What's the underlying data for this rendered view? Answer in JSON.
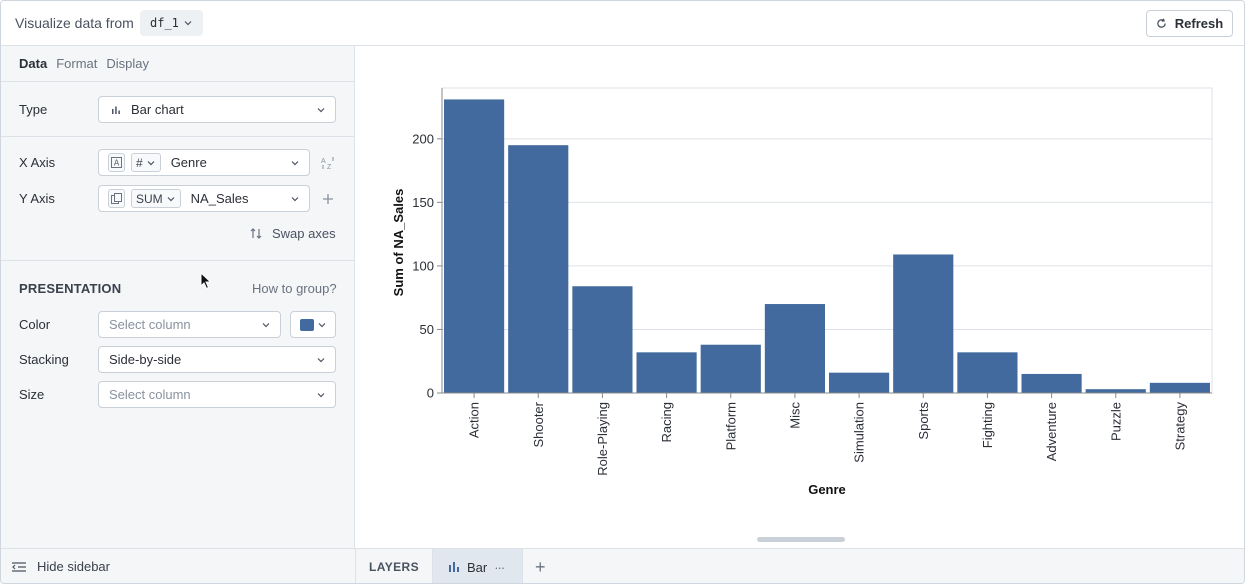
{
  "header": {
    "title": "Visualize data from",
    "dataframe": "df_1",
    "refresh_label": "Refresh"
  },
  "sidebar": {
    "tabs": [
      {
        "label": "Data",
        "active": true
      },
      {
        "label": "Format",
        "active": false
      },
      {
        "label": "Display",
        "active": false
      }
    ],
    "type": {
      "label": "Type",
      "value": "Bar chart",
      "icon": "bar-chart-icon"
    },
    "x_axis": {
      "label": "X Axis",
      "type_chip": "#",
      "column": "Genre",
      "sort_icon": "sort-az-icon"
    },
    "y_axis": {
      "label": "Y Axis",
      "agg_chip": "SUM",
      "column": "NA_Sales",
      "add_icon": "plus-icon"
    },
    "swap_axes_label": "Swap axes",
    "presentation": {
      "title": "PRESENTATION",
      "how_to_group": "How to group?",
      "color": {
        "label": "Color",
        "placeholder": "Select column",
        "swatch": "#426a9e"
      },
      "stacking": {
        "label": "Stacking",
        "value": "Side-by-side"
      },
      "size": {
        "label": "Size",
        "placeholder": "Select column"
      }
    }
  },
  "bottombar": {
    "hide_sidebar": "Hide sidebar",
    "layers_label": "LAYERS",
    "layer_tab": "Bar",
    "more": "···",
    "add": "+"
  },
  "colors": {
    "bar": "#426a9e",
    "accent": "#426a9e"
  },
  "chart_data": {
    "type": "bar",
    "categories": [
      "Action",
      "Shooter",
      "Role-Playing",
      "Racing",
      "Platform",
      "Misc",
      "Simulation",
      "Sports",
      "Fighting",
      "Adventure",
      "Puzzle",
      "Strategy"
    ],
    "series": [
      {
        "values": [
          231,
          195,
          84,
          32,
          38,
          70,
          16,
          109,
          32,
          15,
          3,
          8
        ]
      }
    ],
    "xlabel": "Genre",
    "ylabel": "Sum of NA_Sales",
    "ylim": [
      0,
      240
    ],
    "yticks": [
      0,
      50,
      100,
      150,
      200
    ],
    "grid": true
  }
}
